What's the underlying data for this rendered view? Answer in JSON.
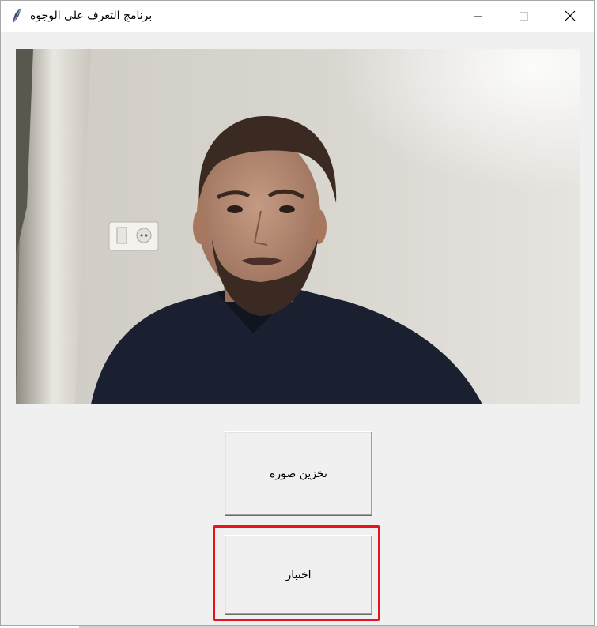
{
  "window": {
    "title": "برنامج التعرف على الوجوه",
    "app_icon": "feather-icon",
    "controls": [
      "minimize-icon",
      "maximize-icon",
      "close-icon"
    ]
  },
  "camera": {
    "content": "webcam-feed"
  },
  "buttons": {
    "save_image": "تخزين صورة",
    "test": "اختبار"
  },
  "colors": {
    "window_bg": "#f0f0f0",
    "titlebar_bg": "#ffffff",
    "highlight": "#e8141c"
  }
}
